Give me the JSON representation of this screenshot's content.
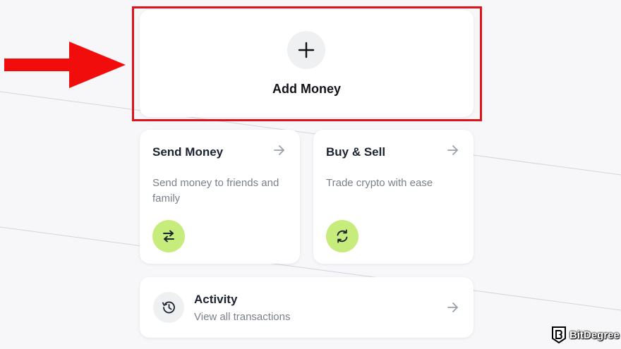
{
  "add_money": {
    "label": "Add Money",
    "icon": "plus-icon"
  },
  "send_money": {
    "title": "Send Money",
    "description": "Send money to friends and family",
    "icon": "swap-arrows-icon",
    "arrow_icon": "arrow-right-icon"
  },
  "buy_sell": {
    "title": "Buy & Sell",
    "description": "Trade crypto with ease",
    "icon": "refresh-icon",
    "arrow_icon": "arrow-right-icon"
  },
  "activity": {
    "title": "Activity",
    "subtitle": "View all transactions",
    "icon": "history-icon",
    "arrow_icon": "arrow-right-icon"
  },
  "annotation": {
    "highlight_color": "#e0121a",
    "arrow_icon": "red-pointer-arrow-icon"
  },
  "watermark": {
    "text": "BitDegree",
    "icon": "bitdegree-logo-icon"
  },
  "colors": {
    "background": "#f7f7f9",
    "card": "#ffffff",
    "accent_lime": "#c6ec7c",
    "icon_bg": "#eff0f2"
  }
}
